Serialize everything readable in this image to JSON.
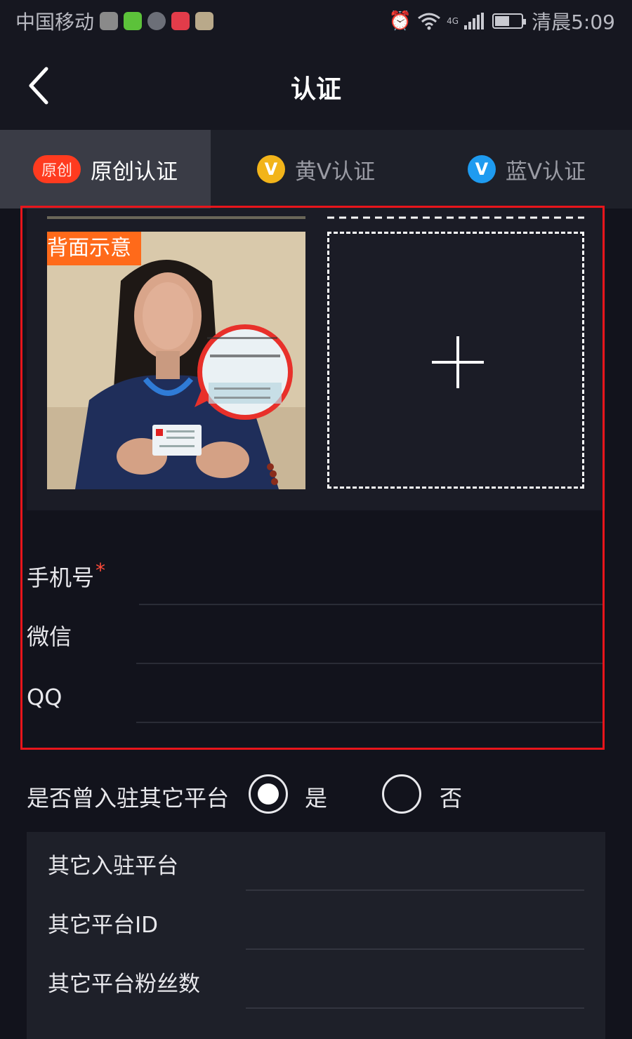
{
  "status_bar": {
    "carrier": "中国移动",
    "network": "4G",
    "time": "清晨5:09",
    "icons": [
      "app-icon-1",
      "app-icon-2",
      "app-icon-3",
      "app-icon-4",
      "app-icon-5",
      "alarm-icon",
      "wifi-icon",
      "signal-icon",
      "battery-icon"
    ]
  },
  "header": {
    "title": "认证",
    "back_icon": "chevron-left-icon"
  },
  "tabs": [
    {
      "badge": "原创",
      "label": "原创认证",
      "active": true
    },
    {
      "badge": "V",
      "label": "黄V认证",
      "badge_color": "#f2b41a",
      "active": false
    },
    {
      "badge": "V",
      "label": "蓝V认证",
      "badge_color": "#1e9bf0",
      "active": false
    }
  ],
  "upload": {
    "sample_label": "背面示意",
    "upload_icon": "plus-icon"
  },
  "form": {
    "phone_label": "手机号",
    "required_mark": "*",
    "wechat_label": "微信",
    "qq_label": "QQ"
  },
  "platform_question": {
    "question": "是否曾入驻其它平台",
    "yes_label": "是",
    "no_label": "否",
    "selected": "是"
  },
  "other_platform": {
    "platform_label": "其它入驻平台",
    "id_label": "其它平台ID",
    "fans_label": "其它平台粉丝数"
  },
  "colors": {
    "background": "#12131c",
    "accent_red": "#e8151b",
    "badge_orange": "#ff3b1f",
    "sample_label_bg": "#ff6a1a"
  }
}
